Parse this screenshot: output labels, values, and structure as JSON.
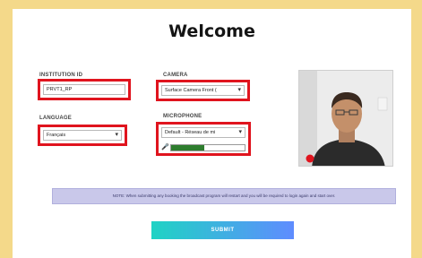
{
  "page": {
    "title": "Welcome"
  },
  "form": {
    "institution": {
      "label": "INSTITUTION ID",
      "value": "PRVT1_RP"
    },
    "language": {
      "label": "LANGUAGE",
      "value": "Français"
    },
    "camera": {
      "label": "CAMERA",
      "value": "Surface Camera Front ("
    },
    "microphone": {
      "label": "MICROPHONE",
      "value": "Default - Réseau de mi",
      "level": 0.45
    }
  },
  "notice": {
    "text": "NOTE: When submitting any booking the broadcast program will restart and you will be required to login again and start over."
  },
  "submit": {
    "label": "SUBMIT"
  },
  "colors": {
    "highlight": "#e0141e",
    "meter": "#2e7d2e",
    "notice_bg": "#c9c8ea",
    "submit_start": "#1fd3c4",
    "submit_end": "#5f8cff"
  },
  "icons": {
    "mic": "microphone-icon",
    "chevron": "chevron-down-icon",
    "record": "record-dot-icon"
  }
}
